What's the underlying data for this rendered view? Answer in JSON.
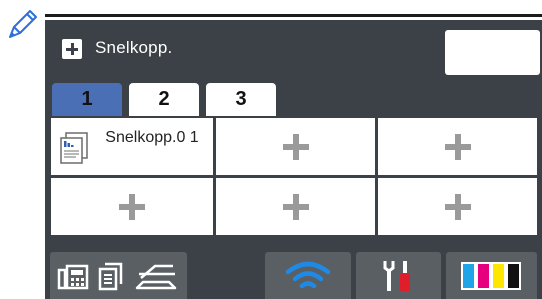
{
  "header": {
    "title": "Snelkopp."
  },
  "tabs": [
    {
      "label": "1",
      "active": true
    },
    {
      "label": "2",
      "active": false
    },
    {
      "label": "3",
      "active": false
    }
  ],
  "shortcuts": [
    {
      "label": "Snelkopp.0 1",
      "icon": "copy-document-icon"
    },
    {
      "label": "",
      "icon": "add-icon"
    },
    {
      "label": "",
      "icon": "add-icon"
    },
    {
      "label": "",
      "icon": "add-icon"
    },
    {
      "label": "",
      "icon": "add-icon"
    },
    {
      "label": "",
      "icon": "add-icon"
    }
  ],
  "bottom_bar": {
    "buttons": [
      {
        "icon": "fax-copy-scan-icons"
      },
      {
        "icon": "wifi-icon"
      },
      {
        "icon": "settings-tools-icon"
      },
      {
        "icon": "ink-cartridges-icon"
      }
    ]
  },
  "colors": {
    "screen_bg": "#3b4146",
    "active_tab": "#4b6fb5",
    "bottom_button": "#5a5f63",
    "wifi": "#1e8ae6",
    "ink_cyan": "#1fa4e8",
    "ink_magenta": "#e6007e",
    "ink_yellow": "#ffe600",
    "ink_black": "#111111"
  }
}
